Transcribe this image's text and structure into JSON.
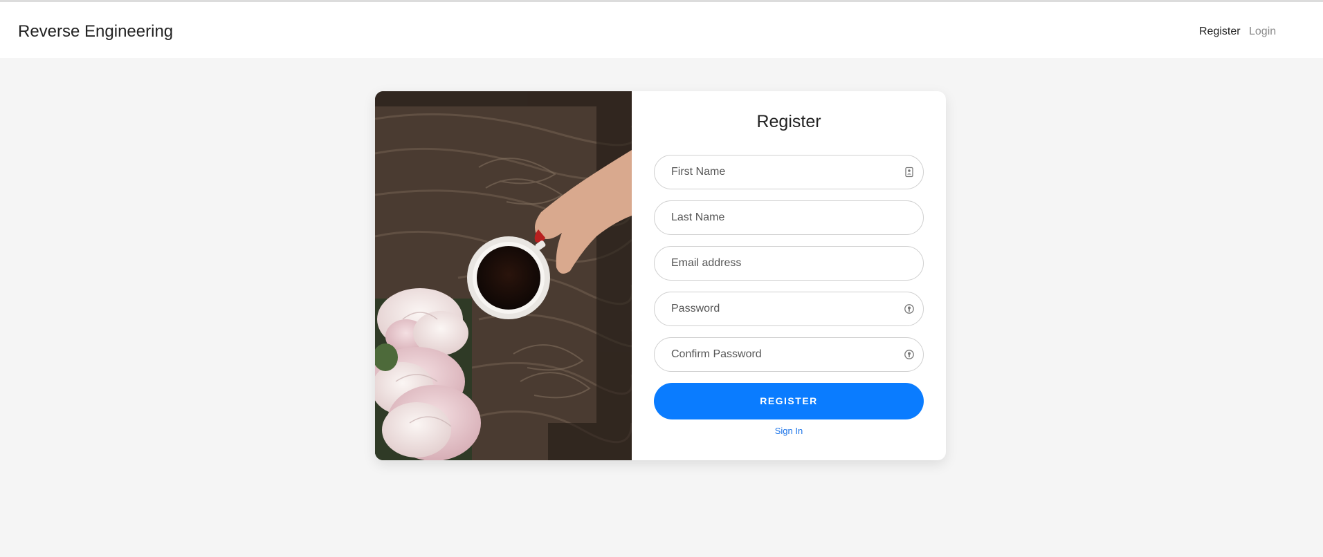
{
  "header": {
    "brand": "Reverse Engineering",
    "nav": {
      "register": "Register",
      "login": "Login"
    }
  },
  "form": {
    "title": "Register",
    "fields": [
      {
        "placeholder": "First Name",
        "value": "",
        "icon": "contact-card-icon"
      },
      {
        "placeholder": "Last Name",
        "value": ""
      },
      {
        "placeholder": "Email address",
        "value": ""
      },
      {
        "placeholder": "Password",
        "value": "",
        "icon": "key-icon"
      },
      {
        "placeholder": "Confirm Password",
        "value": "",
        "icon": "key-icon"
      }
    ],
    "submit_label": "REGISTER",
    "signin_link": "Sign In"
  },
  "colors": {
    "accent": "#0a7cff",
    "link": "#1a73e8",
    "background": "#f5f5f5"
  }
}
